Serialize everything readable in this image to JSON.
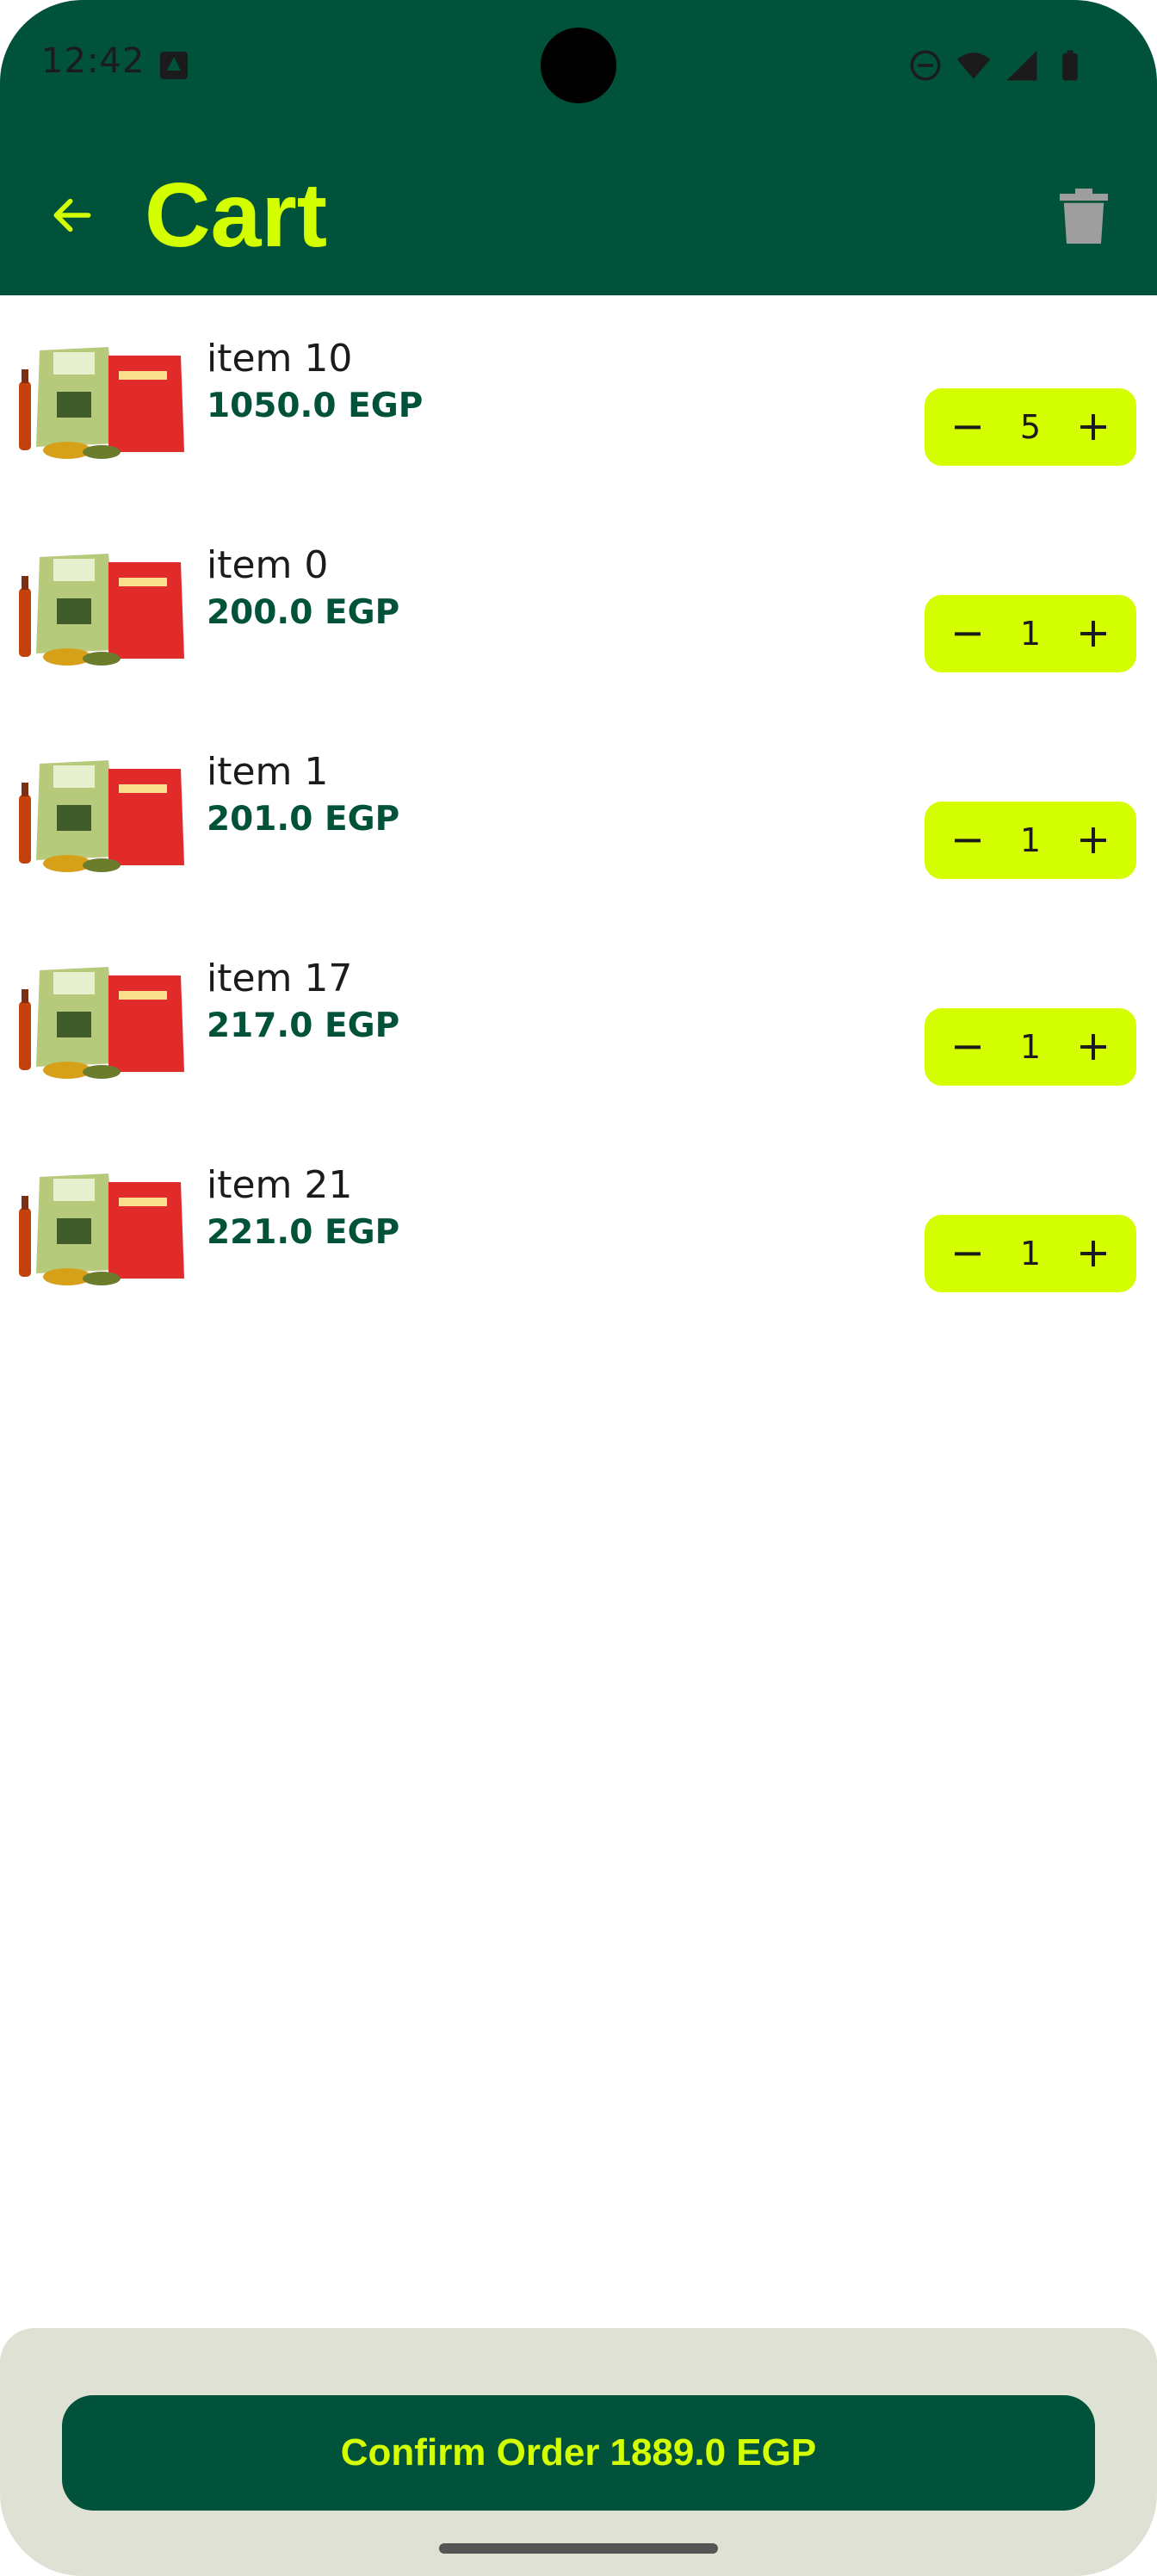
{
  "status_bar": {
    "time": "12:42"
  },
  "app_bar": {
    "title": "Cart"
  },
  "cart": {
    "items": [
      {
        "name": "item 10",
        "price": "1050.0 EGP",
        "quantity": "5"
      },
      {
        "name": "item 0",
        "price": "200.0 EGP",
        "quantity": "1"
      },
      {
        "name": "item 1",
        "price": "201.0 EGP",
        "quantity": "1"
      },
      {
        "name": "item 17",
        "price": "217.0 EGP",
        "quantity": "1"
      },
      {
        "name": "item 21",
        "price": "221.0 EGP",
        "quantity": "1"
      }
    ]
  },
  "footer": {
    "confirm_label": "Confirm Order",
    "total": "1889.0 EGP"
  },
  "colors": {
    "primary": "#00533a",
    "accent": "#d4ff00",
    "footer_bg": "#dfe1d4"
  },
  "icons": {
    "back": "arrow-back-icon",
    "delete": "trash-icon",
    "decrement": "minus-icon",
    "increment": "plus-icon"
  }
}
